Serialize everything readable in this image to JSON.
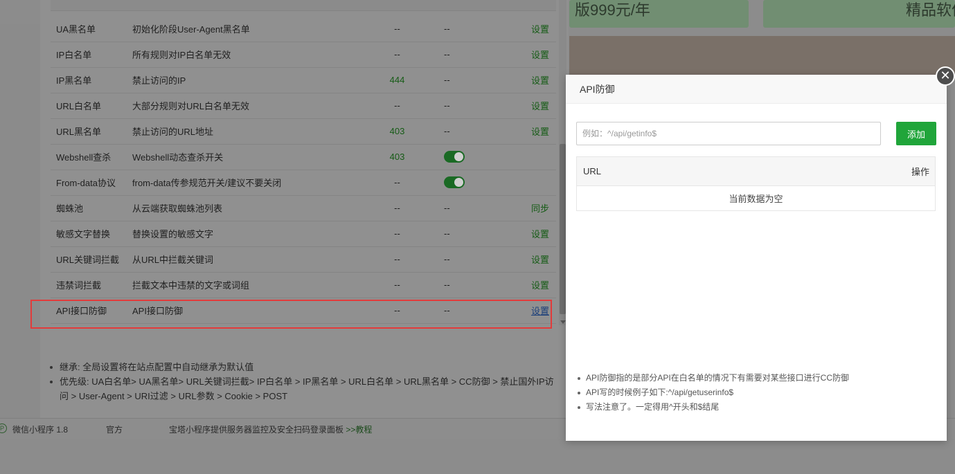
{
  "background": {
    "cards": [
      "版999元/年",
      "精品软件"
    ],
    "footer": {
      "mini_program_icon": "P",
      "mini_program": "微信小程序 1.8",
      "official": "官方",
      "description": "宝塔小程序提供服务器监控及安全扫码登录面板 ",
      "tutorial_link": ">>教程"
    }
  },
  "rules_table": {
    "rows": [
      {
        "name": "UA黑名单",
        "desc": "初始化阶段User-Agent黑名单",
        "v1": "--",
        "v2": "--",
        "op": "设置"
      },
      {
        "name": "IP白名单",
        "desc": "所有规则对IP白名单无效",
        "v1": "--",
        "v2": "--",
        "op": "设置"
      },
      {
        "name": "IP黑名单",
        "desc": "禁止访问的IP",
        "v1": "444",
        "v2": "--",
        "op": "设置"
      },
      {
        "name": "URL白名单",
        "desc": "大部分规则对URL白名单无效",
        "v1": "--",
        "v2": "--",
        "op": "设置"
      },
      {
        "name": "URL黑名单",
        "desc": "禁止访问的URL地址",
        "v1": "403",
        "v2": "--",
        "op": "设置"
      },
      {
        "name": "Webshell查杀",
        "desc": "Webshell动态查杀开关",
        "v1": "403",
        "v2": "toggle-on",
        "op": ""
      },
      {
        "name": "From-data协议",
        "desc": "from-data传参规范开关/建议不要关闭",
        "v1": "--",
        "v2": "toggle-on",
        "op": ""
      },
      {
        "name": "蜘蛛池",
        "desc": "从云端获取蜘蛛池列表",
        "v1": "--",
        "v2": "--",
        "op": "同步"
      },
      {
        "name": "敏感文字替换",
        "desc": "替换设置的敏感文字",
        "v1": "--",
        "v2": "--",
        "op": "设置"
      },
      {
        "name": "URL关键词拦截",
        "desc": "从URL中拦截关键词",
        "v1": "--",
        "v2": "--",
        "op": "设置"
      },
      {
        "name": "违禁词拦截",
        "desc": "拦截文本中违禁的文字或词组",
        "v1": "--",
        "v2": "--",
        "op": "设置"
      },
      {
        "name": "API接口防御",
        "desc": "API接口防御",
        "v1": "--",
        "v2": "--",
        "op": "设置"
      }
    ]
  },
  "main_notes": [
    "继承: 全局设置将在站点配置中自动继承为默认值",
    "优先级: UA白名单> UA黑名单> URL关键词拦截> IP白名单 > IP黑名单 > URL白名单 > URL黑名单 > CC防御 > 禁止国外IP访问 > User-Agent > URI过滤 > URL参数 > Cookie > POST"
  ],
  "api_dialog": {
    "title": "API防御",
    "close_symbol": "✕",
    "input_placeholder": "例如：^/api/getinfo$",
    "add_button": "添加",
    "table": {
      "col_url": "URL",
      "col_op": "操作",
      "empty_text": "当前数据为空"
    },
    "notes": [
      "API防御指的是部分API在白名单的情况下有需要对某些接口进行CC防御",
      "API写的时候例子如下:^/api/getuserinfo$",
      "写法注意了。一定得用^开头和$结尾"
    ]
  },
  "colors": {
    "accent_green": "#20a53a",
    "highlight_red": "#e23b3b"
  }
}
